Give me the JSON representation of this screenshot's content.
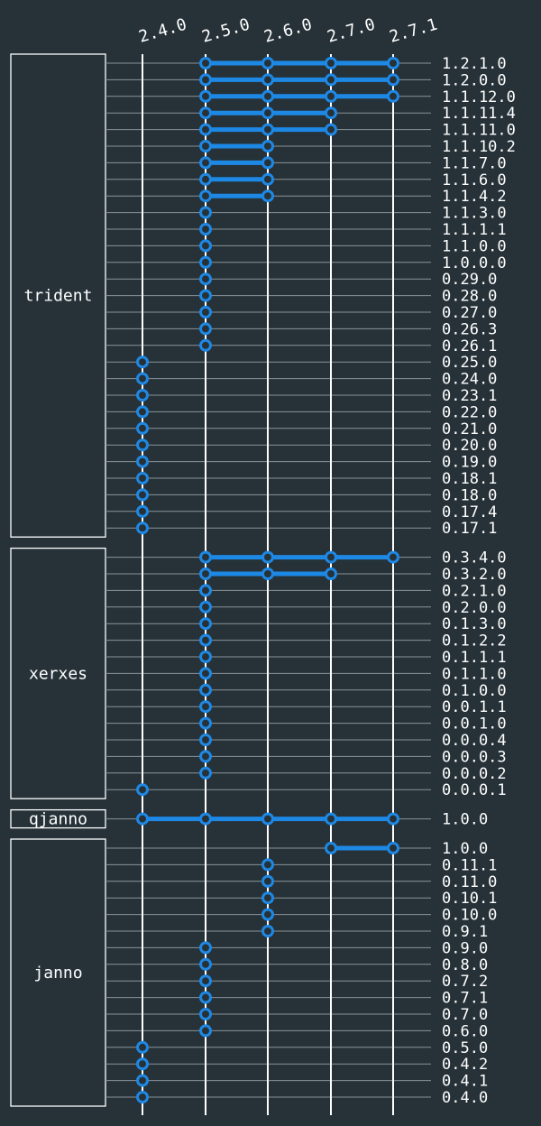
{
  "colors": {
    "background": "#263238",
    "accent": "#1e88e5",
    "line": "#ffffff",
    "grid": "#8a939a"
  },
  "columns": [
    "2.4.0",
    "2.5.0",
    "2.6.0",
    "2.7.0",
    "2.7.1"
  ],
  "groups": [
    {
      "name": "trident",
      "rows": [
        {
          "version": "1.2.1.0",
          "supported": [
            "2.5.0",
            "2.6.0",
            "2.7.0",
            "2.7.1"
          ]
        },
        {
          "version": "1.2.0.0",
          "supported": [
            "2.5.0",
            "2.6.0",
            "2.7.0",
            "2.7.1"
          ]
        },
        {
          "version": "1.1.12.0",
          "supported": [
            "2.5.0",
            "2.6.0",
            "2.7.0",
            "2.7.1"
          ]
        },
        {
          "version": "1.1.11.4",
          "supported": [
            "2.5.0",
            "2.6.0",
            "2.7.0"
          ]
        },
        {
          "version": "1.1.11.0",
          "supported": [
            "2.5.0",
            "2.6.0",
            "2.7.0"
          ]
        },
        {
          "version": "1.1.10.2",
          "supported": [
            "2.5.0",
            "2.6.0"
          ]
        },
        {
          "version": "1.1.7.0",
          "supported": [
            "2.5.0",
            "2.6.0"
          ]
        },
        {
          "version": "1.1.6.0",
          "supported": [
            "2.5.0",
            "2.6.0"
          ]
        },
        {
          "version": "1.1.4.2",
          "supported": [
            "2.5.0",
            "2.6.0"
          ]
        },
        {
          "version": "1.1.3.0",
          "supported": [
            "2.5.0"
          ]
        },
        {
          "version": "1.1.1.1",
          "supported": [
            "2.5.0"
          ]
        },
        {
          "version": "1.1.0.0",
          "supported": [
            "2.5.0"
          ]
        },
        {
          "version": "1.0.0.0",
          "supported": [
            "2.5.0"
          ]
        },
        {
          "version": "0.29.0",
          "supported": [
            "2.5.0"
          ]
        },
        {
          "version": "0.28.0",
          "supported": [
            "2.5.0"
          ]
        },
        {
          "version": "0.27.0",
          "supported": [
            "2.5.0"
          ]
        },
        {
          "version": "0.26.3",
          "supported": [
            "2.5.0"
          ]
        },
        {
          "version": "0.26.1",
          "supported": [
            "2.5.0"
          ]
        },
        {
          "version": "0.25.0",
          "supported": [
            "2.4.0"
          ]
        },
        {
          "version": "0.24.0",
          "supported": [
            "2.4.0"
          ]
        },
        {
          "version": "0.23.1",
          "supported": [
            "2.4.0"
          ]
        },
        {
          "version": "0.22.0",
          "supported": [
            "2.4.0"
          ]
        },
        {
          "version": "0.21.0",
          "supported": [
            "2.4.0"
          ]
        },
        {
          "version": "0.20.0",
          "supported": [
            "2.4.0"
          ]
        },
        {
          "version": "0.19.0",
          "supported": [
            "2.4.0"
          ]
        },
        {
          "version": "0.18.1",
          "supported": [
            "2.4.0"
          ]
        },
        {
          "version": "0.18.0",
          "supported": [
            "2.4.0"
          ]
        },
        {
          "version": "0.17.4",
          "supported": [
            "2.4.0"
          ]
        },
        {
          "version": "0.17.1",
          "supported": [
            "2.4.0"
          ]
        }
      ]
    },
    {
      "name": "xerxes",
      "rows": [
        {
          "version": "0.3.4.0",
          "supported": [
            "2.5.0",
            "2.6.0",
            "2.7.0",
            "2.7.1"
          ]
        },
        {
          "version": "0.3.2.0",
          "supported": [
            "2.5.0",
            "2.6.0",
            "2.7.0"
          ]
        },
        {
          "version": "0.2.1.0",
          "supported": [
            "2.5.0"
          ]
        },
        {
          "version": "0.2.0.0",
          "supported": [
            "2.5.0"
          ]
        },
        {
          "version": "0.1.3.0",
          "supported": [
            "2.5.0"
          ]
        },
        {
          "version": "0.1.2.2",
          "supported": [
            "2.5.0"
          ]
        },
        {
          "version": "0.1.1.1",
          "supported": [
            "2.5.0"
          ]
        },
        {
          "version": "0.1.1.0",
          "supported": [
            "2.5.0"
          ]
        },
        {
          "version": "0.1.0.0",
          "supported": [
            "2.5.0"
          ]
        },
        {
          "version": "0.0.1.1",
          "supported": [
            "2.5.0"
          ]
        },
        {
          "version": "0.0.1.0",
          "supported": [
            "2.5.0"
          ]
        },
        {
          "version": "0.0.0.4",
          "supported": [
            "2.5.0"
          ]
        },
        {
          "version": "0.0.0.3",
          "supported": [
            "2.5.0"
          ]
        },
        {
          "version": "0.0.0.2",
          "supported": [
            "2.5.0"
          ]
        },
        {
          "version": "0.0.0.1",
          "supported": [
            "2.4.0"
          ]
        }
      ]
    },
    {
      "name": "qjanno",
      "rows": [
        {
          "version": "1.0.0",
          "supported": [
            "2.4.0",
            "2.5.0",
            "2.6.0",
            "2.7.0",
            "2.7.1"
          ]
        }
      ]
    },
    {
      "name": "janno",
      "rows": [
        {
          "version": "1.0.0",
          "supported": [
            "2.7.0",
            "2.7.1"
          ]
        },
        {
          "version": "0.11.1",
          "supported": [
            "2.6.0"
          ]
        },
        {
          "version": "0.11.0",
          "supported": [
            "2.6.0"
          ]
        },
        {
          "version": "0.10.1",
          "supported": [
            "2.6.0"
          ]
        },
        {
          "version": "0.10.0",
          "supported": [
            "2.6.0"
          ]
        },
        {
          "version": "0.9.1",
          "supported": [
            "2.6.0"
          ]
        },
        {
          "version": "0.9.0",
          "supported": [
            "2.5.0"
          ]
        },
        {
          "version": "0.8.0",
          "supported": [
            "2.5.0"
          ]
        },
        {
          "version": "0.7.2",
          "supported": [
            "2.5.0"
          ]
        },
        {
          "version": "0.7.1",
          "supported": [
            "2.5.0"
          ]
        },
        {
          "version": "0.7.0",
          "supported": [
            "2.5.0"
          ]
        },
        {
          "version": "0.6.0",
          "supported": [
            "2.5.0"
          ]
        },
        {
          "version": "0.5.0",
          "supported": [
            "2.4.0"
          ]
        },
        {
          "version": "0.4.2",
          "supported": [
            "2.4.0"
          ]
        },
        {
          "version": "0.4.1",
          "supported": [
            "2.4.0"
          ]
        },
        {
          "version": "0.4.0",
          "supported": [
            "2.4.0"
          ]
        }
      ]
    }
  ]
}
